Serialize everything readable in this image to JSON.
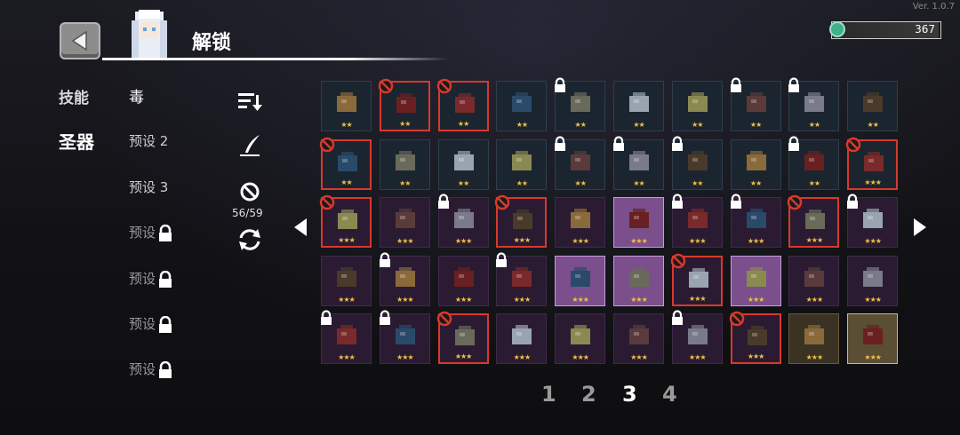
{
  "version": "Ver. 1.0.7",
  "header": {
    "title": "解锁",
    "currency": "367"
  },
  "categories": [
    "技能",
    "圣器"
  ],
  "presets": [
    {
      "label": "毒",
      "locked": false
    },
    {
      "label": "预设 2",
      "locked": false
    },
    {
      "label": "预设 3",
      "locked": false
    },
    {
      "label": "预设",
      "locked": true
    },
    {
      "label": "预设",
      "locked": true
    },
    {
      "label": "预设",
      "locked": true
    },
    {
      "label": "预设",
      "locked": true
    }
  ],
  "toolbar": {
    "ban_count": "56/59"
  },
  "grid": {
    "rows": [
      [
        {
          "s": "★★",
          "b": ""
        },
        {
          "s": "★★",
          "b": "ban"
        },
        {
          "s": "★★",
          "b": "ban"
        },
        {
          "s": "★★",
          "b": ""
        },
        {
          "s": "★★",
          "b": "lock"
        },
        {
          "s": "★★",
          "b": ""
        },
        {
          "s": "★★",
          "b": ""
        },
        {
          "s": "★★",
          "b": "lock"
        },
        {
          "s": "★★",
          "b": "lock"
        },
        {
          "s": "★★",
          "b": ""
        }
      ],
      [
        {
          "s": "★★",
          "b": "ban"
        },
        {
          "s": "★★",
          "b": ""
        },
        {
          "s": "★★",
          "b": ""
        },
        {
          "s": "★★",
          "b": ""
        },
        {
          "s": "★★",
          "b": "lock"
        },
        {
          "s": "★★",
          "b": "lock"
        },
        {
          "s": "★★",
          "b": "lock"
        },
        {
          "s": "★★",
          "b": ""
        },
        {
          "s": "★★",
          "b": "lock"
        },
        {
          "s": "★★★",
          "b": "ban"
        }
      ],
      [
        {
          "s": "★★★",
          "b": "ban"
        },
        {
          "s": "★★★",
          "b": ""
        },
        {
          "s": "★★★",
          "b": "lock"
        },
        {
          "s": "★★★",
          "b": "ban"
        },
        {
          "s": "★★★",
          "b": ""
        },
        {
          "s": "★★★",
          "b": ""
        },
        {
          "s": "★★★",
          "b": "lock"
        },
        {
          "s": "★★★",
          "b": "lock"
        },
        {
          "s": "★★★",
          "b": "ban"
        },
        {
          "s": "★★★",
          "b": "lock"
        }
      ],
      [
        {
          "s": "★★★",
          "b": ""
        },
        {
          "s": "★★★",
          "b": "lock"
        },
        {
          "s": "★★★",
          "b": ""
        },
        {
          "s": "★★★",
          "b": "lock"
        },
        {
          "s": "★★★",
          "b": ""
        },
        {
          "s": "★★★",
          "b": ""
        },
        {
          "s": "★★★",
          "b": "ban"
        },
        {
          "s": "★★★",
          "b": ""
        },
        {
          "s": "★★★",
          "b": ""
        },
        {
          "s": "★★★",
          "b": ""
        }
      ],
      [
        {
          "s": "★★★",
          "b": "lock"
        },
        {
          "s": "★★★",
          "b": "lock"
        },
        {
          "s": "★★★",
          "b": "ban"
        },
        {
          "s": "★★★",
          "b": ""
        },
        {
          "s": "★★★",
          "b": ""
        },
        {
          "s": "★★★",
          "b": ""
        },
        {
          "s": "★★★",
          "b": "lock"
        },
        {
          "s": "★★★",
          "b": "ban"
        },
        {
          "s": "★★★",
          "b": ""
        },
        {
          "s": "★★★",
          "b": ""
        }
      ]
    ]
  },
  "pagination": [
    "1",
    "2",
    "3",
    "4"
  ],
  "current_page": "3",
  "colors": {
    "ban": "#d9382c",
    "star": "#f0c040",
    "highlight": "#c89ae0"
  },
  "icons": {
    "back": "back-arrow-icon",
    "sort": "sort-icon",
    "edit": "quill-icon",
    "ban": "ban-icon",
    "refresh": "refresh-icon",
    "lock": "lock-icon",
    "gem": "gem-icon"
  }
}
